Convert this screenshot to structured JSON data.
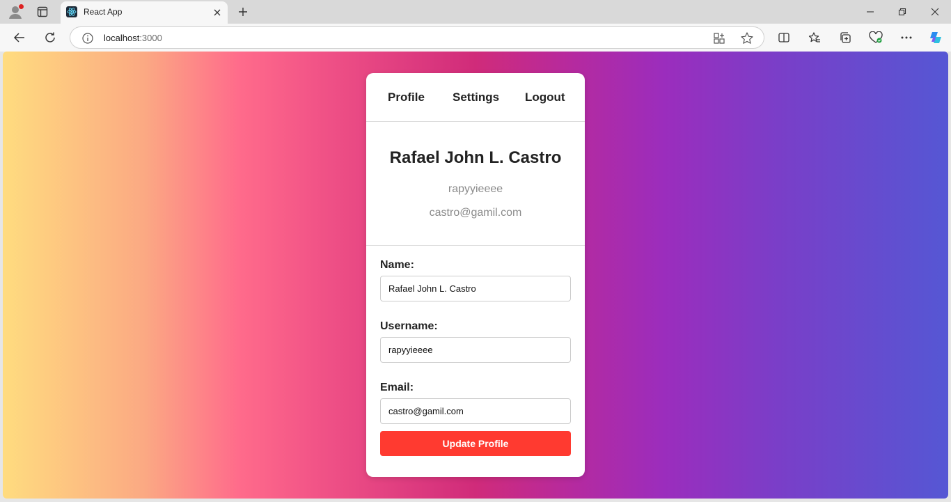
{
  "browser": {
    "tab": {
      "title": "React App"
    },
    "address_bar": {
      "host": "localhost",
      "port": ":3000"
    },
    "icons": [
      "profile-icon",
      "tabs-icon",
      "react-favicon-icon",
      "close-icon",
      "plus-icon",
      "minimize-icon",
      "restore-icon",
      "window-close-icon",
      "back-icon",
      "reload-icon",
      "info-icon",
      "app-available-icon",
      "star-icon",
      "split-screen-icon",
      "favorites-icon",
      "collections-icon",
      "browser-health-icon",
      "more-icon",
      "copilot-icon"
    ]
  },
  "nav": {
    "profile": "Profile",
    "settings": "Settings",
    "logout": "Logout"
  },
  "profile": {
    "full_name": "Rafael John L. Castro",
    "username": "rapyyieeee",
    "email": "castro@gamil.com"
  },
  "form": {
    "name_label": "Name:",
    "name_value": "Rafael John L. Castro",
    "username_label": "Username:",
    "username_value": "rapyyieeee",
    "email_label": "Email:",
    "email_value": "castro@gamil.com",
    "submit_label": "Update Profile"
  },
  "colors": {
    "accent_button": "#ff3a30",
    "gradient_start": "#ffdc7f",
    "gradient_mid": "#d02b7a",
    "gradient_end": "#5557d4"
  }
}
